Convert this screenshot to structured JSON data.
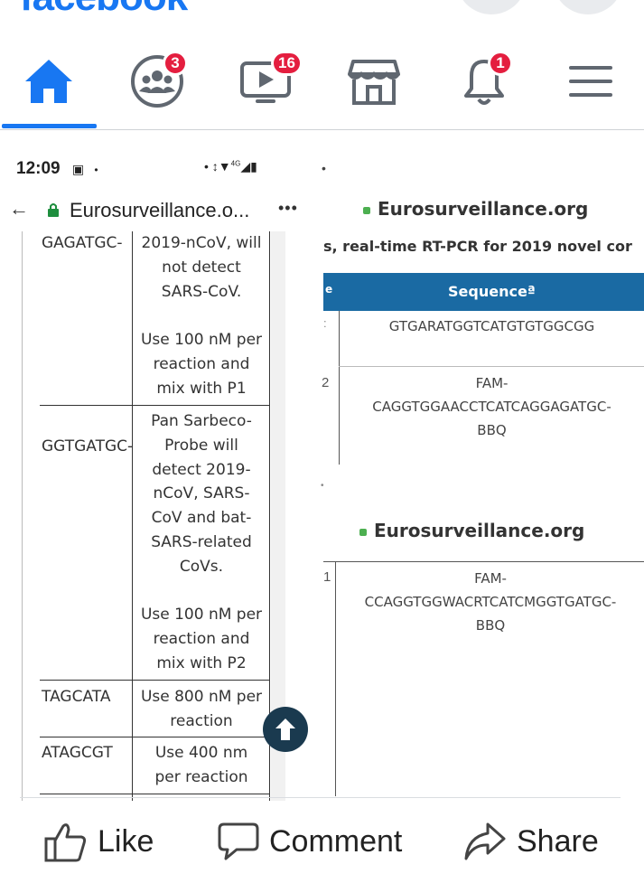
{
  "brand": {
    "text": "facebook",
    "color": "#1877f2"
  },
  "nav": {
    "items": [
      {
        "name": "home",
        "icon": "home-icon",
        "active": true
      },
      {
        "name": "groups",
        "icon": "groups-icon",
        "badge": "3"
      },
      {
        "name": "watch",
        "icon": "video-icon",
        "badge": "16"
      },
      {
        "name": "marketplace",
        "icon": "store-icon"
      },
      {
        "name": "notifications",
        "icon": "bell-icon",
        "badge": "1"
      },
      {
        "name": "menu",
        "icon": "hamburger-icon"
      }
    ],
    "accent_color": "#1877f2",
    "badge_color": "#e41e3f"
  },
  "phone": {
    "status": {
      "time": "12:09",
      "network": "4G"
    },
    "url": "Eurosurveillance.o...",
    "more": "•••",
    "rows": [
      {
        "seq": "GAGATGC-",
        "note": "2019-nCoV, will\nnot detect\nSARS-CoV.\n\nUse 100 nM per\nreaction and\nmix with P1"
      },
      {
        "seq": "GGTGATGC-",
        "note": "Pan Sarbeco-\nProbe will\ndetect 2019-\nnCoV, SARS-\nCoV and bat-\nSARS-related\nCoVs.\n\nUse 100 nM per\nreaction and\nmix with P2"
      },
      {
        "seq": "TAGCATA",
        "note": "Use 800 nM per\nreaction"
      },
      {
        "seq": "ATAGCGT",
        "note": "Use 400 nm\nper reaction"
      }
    ]
  },
  "crop1": {
    "site": "Eurosurveillance.org",
    "subtitle": "s, real-time RT-PCR for 2019 novel cor",
    "header_left": "e",
    "header": "Sequenceª",
    "row1_left": ":",
    "row1": "GTGARATGGTCATGTGTGGCGG",
    "row2_left": "2",
    "row2": "FAM-\nCAGGTGGAACCTCATCAGGAGATGC-\nBBQ"
  },
  "crop2": {
    "site": "Eurosurveillance.org",
    "row1_left": "1",
    "row1": "FAM-\nCCAGGTGGWACRTCATCMGGTGATGC-\nBBQ"
  },
  "actions": {
    "like": "Like",
    "comment": "Comment",
    "share": "Share"
  }
}
